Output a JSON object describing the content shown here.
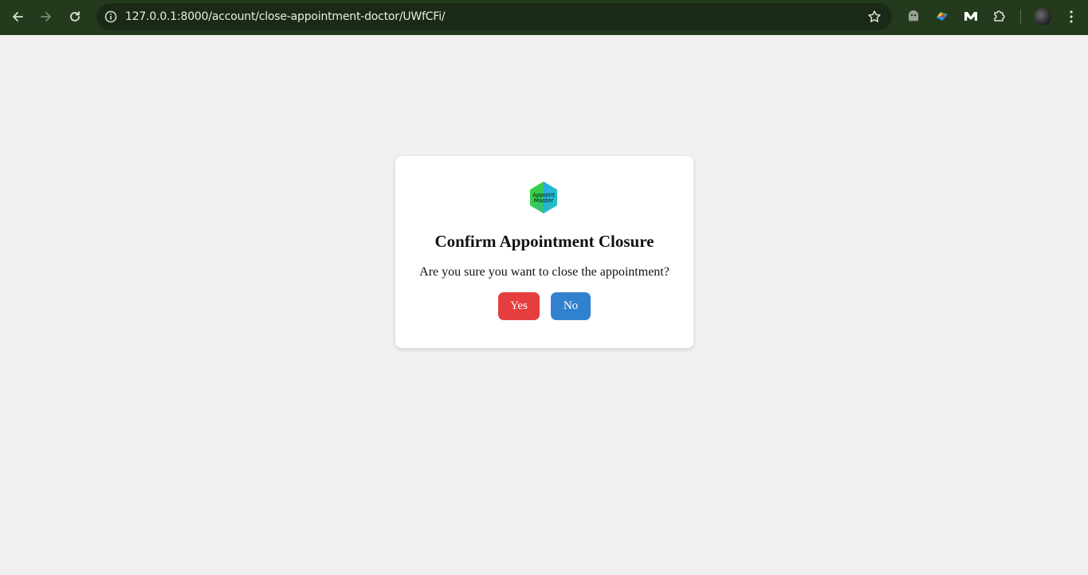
{
  "browser": {
    "url": "127.0.0.1:8000/account/close-appointment-doctor/UWfCFi/",
    "icons": {
      "back": "arrow-left-icon",
      "forward": "arrow-right-icon",
      "reload": "reload-icon",
      "site_info": "info-icon",
      "bookmark": "star-icon",
      "extensions": "puzzle-icon",
      "menu": "vertical-dots-icon"
    }
  },
  "dialog": {
    "logo_text_line1": "Appoint",
    "logo_text_line2": "Master",
    "title": "Confirm Appointment Closure",
    "message": "Are you sure you want to close the appointment?",
    "yes_label": "Yes",
    "no_label": "No",
    "colors": {
      "yes": "#e53e3e",
      "no": "#3182ce",
      "background": "#f0f0f0",
      "card": "#ffffff"
    }
  }
}
